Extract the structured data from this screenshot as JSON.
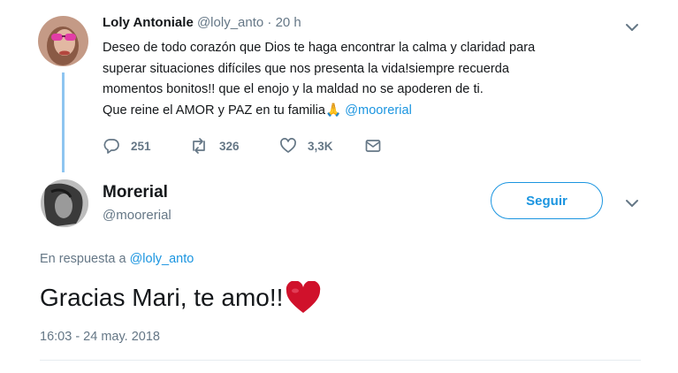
{
  "parent_tweet": {
    "author_name": "Loly Antoniale",
    "author_handle": "@loly_anto",
    "separator": " · ",
    "time": "20 h",
    "text_lines": [
      "Deseo de todo corazón que Dios te haga encontrar la calma y claridad para",
      "superar situaciones difíciles que nos presenta la vida!siempre recuerda",
      "momentos bonitos!! que el enojo y la maldad no se apoderen de ti."
    ],
    "last_line_text": "Que reine el AMOR y PAZ en tu familia",
    "last_line_emoji": "🙏",
    "mention": "@moorerial",
    "replies": "251",
    "retweets": "326",
    "likes": "3,3K",
    "icons": [
      "reply-icon",
      "retweet-icon",
      "like-icon",
      "message-icon",
      "chevron-down-icon"
    ]
  },
  "reply_tweet": {
    "author_name": "Morerial",
    "author_handle": "@moorerial",
    "follow_label": "Seguir",
    "in_reply_prefix": "En respuesta a ",
    "in_reply_handle": "@loly_anto",
    "text": "Gracias Mari, te amo!!",
    "emoji": "heart",
    "timestamp": "16:03 - 24 may. 2018"
  },
  "colors": {
    "link": "#1b95e0",
    "muted": "#657786",
    "thread_line": "#8ec5f0",
    "heart": "#d0112b",
    "text": "#14171a"
  }
}
